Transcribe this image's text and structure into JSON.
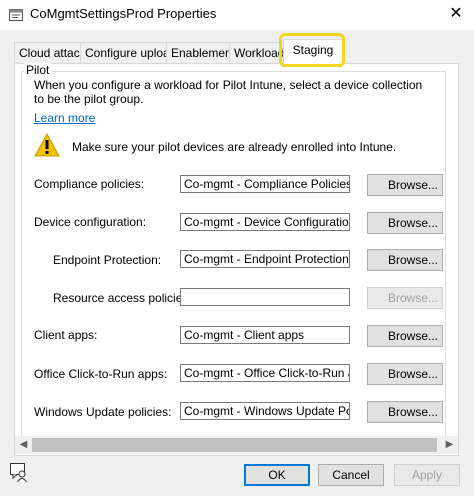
{
  "window": {
    "title": "CoMgmtSettingsProd Properties",
    "close_glyph": "✕"
  },
  "tabs": [
    {
      "label": "Cloud attach"
    },
    {
      "label": "Configure upload"
    },
    {
      "label": "Enablement"
    },
    {
      "label": "Workloads"
    },
    {
      "label": "Staging"
    }
  ],
  "active_tab": "Staging",
  "pilot": {
    "group_title": "Pilot",
    "description": "When you configure a workload for Pilot Intune, select a device collection to be the pilot group.",
    "learn_more": "Learn more",
    "warning": "Make sure your pilot devices are already enrolled into Intune.",
    "rows": [
      {
        "label": "Compliance policies:",
        "value": "Co-mgmt - Compliance Policies",
        "button": "Browse... (C)",
        "enabled": true
      },
      {
        "label": "Device configuration:",
        "value": "Co-mgmt - Device Configuration",
        "button": "Browse... (D)",
        "enabled": true
      },
      {
        "label": "Endpoint Protection:",
        "value": "Co-mgmt - Endpoint Protection",
        "button": "Browse... (E)",
        "enabled": true
      },
      {
        "label": "Resource access policies:",
        "value": "",
        "button": "Browse... (R)",
        "enabled": false
      },
      {
        "label": "Client apps:",
        "value": "Co-mgmt - Client apps",
        "button": "Browse... (L)",
        "enabled": true
      },
      {
        "label": "Office Click-to-Run apps:",
        "value": "Co-mgmt - Office Click-to-Run apps",
        "button": "Browse... (F)",
        "enabled": true
      },
      {
        "label": "Windows Update policies:",
        "value": "Co-mgmt - Windows Update Policies",
        "button": "Browse... (W)",
        "enabled": true
      }
    ]
  },
  "footer": {
    "ok": "OK",
    "cancel": "Cancel",
    "apply": "Apply"
  },
  "colors": {
    "accent": "#0078d7",
    "highlight": "#f1d71e",
    "link": "#0066cc"
  }
}
